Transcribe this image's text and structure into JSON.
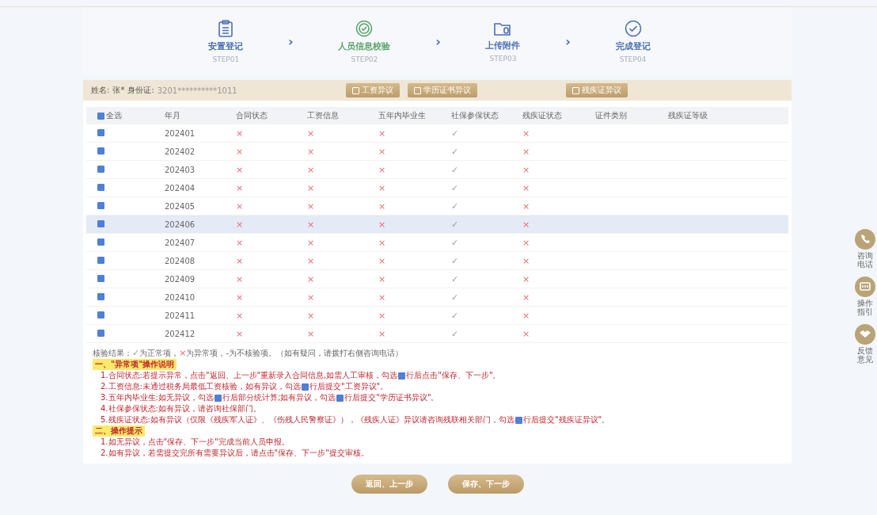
{
  "steps": [
    {
      "label": "安置登记",
      "sub": "STEP01",
      "selected": false
    },
    {
      "label": "人员信息校验",
      "sub": "STEP02",
      "selected": true
    },
    {
      "label": "上传附件",
      "sub": "STEP03",
      "selected": false
    },
    {
      "label": "完成登记",
      "sub": "STEP04",
      "selected": false
    }
  ],
  "step_separator": "›",
  "person": {
    "name_label": "姓名:",
    "name": "张*",
    "id_label": "身份证:",
    "id": "3201**********1011"
  },
  "objection_buttons": [
    "工资异议",
    "学历证书异议",
    "残疾证异议"
  ],
  "table": {
    "select_all": {
      "label": "全选",
      "checked": true
    },
    "columns": [
      "年月",
      "合同状态",
      "工资信息",
      "五年内毕业生",
      "社保参保状态",
      "残疾证状态",
      "证件类别",
      "残疾证等级"
    ],
    "rows": [
      {
        "month": "202401",
        "checked": true,
        "selected": false,
        "marks": [
          {
            "text": "×",
            "ok": false
          },
          {
            "text": "×",
            "ok": false
          },
          {
            "text": "×",
            "ok": false
          },
          {
            "text": "✓",
            "ok": true
          },
          {
            "text": "×",
            "ok": false
          }
        ]
      },
      {
        "month": "202402",
        "checked": true,
        "selected": false,
        "marks": [
          {
            "text": "×",
            "ok": false
          },
          {
            "text": "×",
            "ok": false
          },
          {
            "text": "×",
            "ok": false
          },
          {
            "text": "✓",
            "ok": true
          },
          {
            "text": "×",
            "ok": false
          }
        ]
      },
      {
        "month": "202403",
        "checked": true,
        "selected": false,
        "marks": [
          {
            "text": "×",
            "ok": false
          },
          {
            "text": "×",
            "ok": false
          },
          {
            "text": "×",
            "ok": false
          },
          {
            "text": "✓",
            "ok": true
          },
          {
            "text": "×",
            "ok": false
          }
        ]
      },
      {
        "month": "202404",
        "checked": true,
        "selected": false,
        "marks": [
          {
            "text": "×",
            "ok": false
          },
          {
            "text": "×",
            "ok": false
          },
          {
            "text": "×",
            "ok": false
          },
          {
            "text": "✓",
            "ok": true
          },
          {
            "text": "×",
            "ok": false
          }
        ]
      },
      {
        "month": "202405",
        "checked": true,
        "selected": false,
        "marks": [
          {
            "text": "×",
            "ok": false
          },
          {
            "text": "×",
            "ok": false
          },
          {
            "text": "×",
            "ok": false
          },
          {
            "text": "✓",
            "ok": true
          },
          {
            "text": "×",
            "ok": false
          }
        ]
      },
      {
        "month": "202406",
        "checked": true,
        "selected": true,
        "marks": [
          {
            "text": "×",
            "ok": false
          },
          {
            "text": "×",
            "ok": false
          },
          {
            "text": "×",
            "ok": false
          },
          {
            "text": "✓",
            "ok": true
          },
          {
            "text": "×",
            "ok": false
          }
        ]
      },
      {
        "month": "202407",
        "checked": true,
        "selected": false,
        "marks": [
          {
            "text": "×",
            "ok": false
          },
          {
            "text": "×",
            "ok": false
          },
          {
            "text": "×",
            "ok": false
          },
          {
            "text": "✓",
            "ok": true
          },
          {
            "text": "×",
            "ok": false
          }
        ]
      },
      {
        "month": "202408",
        "checked": true,
        "selected": false,
        "marks": [
          {
            "text": "×",
            "ok": false
          },
          {
            "text": "×",
            "ok": false
          },
          {
            "text": "×",
            "ok": false
          },
          {
            "text": "✓",
            "ok": true
          },
          {
            "text": "×",
            "ok": false
          }
        ]
      },
      {
        "month": "202409",
        "checked": true,
        "selected": false,
        "marks": [
          {
            "text": "×",
            "ok": false
          },
          {
            "text": "×",
            "ok": false
          },
          {
            "text": "×",
            "ok": false
          },
          {
            "text": "✓",
            "ok": true
          },
          {
            "text": "×",
            "ok": false
          }
        ]
      },
      {
        "month": "202410",
        "checked": true,
        "selected": false,
        "marks": [
          {
            "text": "×",
            "ok": false
          },
          {
            "text": "×",
            "ok": false
          },
          {
            "text": "×",
            "ok": false
          },
          {
            "text": "✓",
            "ok": true
          },
          {
            "text": "×",
            "ok": false
          }
        ]
      },
      {
        "month": "202411",
        "checked": true,
        "selected": false,
        "marks": [
          {
            "text": "×",
            "ok": false
          },
          {
            "text": "×",
            "ok": false
          },
          {
            "text": "×",
            "ok": false
          },
          {
            "text": "✓",
            "ok": true
          },
          {
            "text": "×",
            "ok": false
          }
        ]
      },
      {
        "month": "202412",
        "checked": true,
        "selected": false,
        "marks": [
          {
            "text": "×",
            "ok": false
          },
          {
            "text": "×",
            "ok": false
          },
          {
            "text": "×",
            "ok": false
          },
          {
            "text": "✓",
            "ok": true
          },
          {
            "text": "×",
            "ok": false
          }
        ]
      }
    ]
  },
  "legend": [
    {
      "text": "核验结果：",
      "kind": "plain"
    },
    {
      "text": "✓",
      "kind": "ok"
    },
    {
      "text": "为正常项，",
      "kind": "plain"
    },
    {
      "text": "×",
      "kind": "bad"
    },
    {
      "text": "为异常项，",
      "kind": "plain"
    },
    {
      "text": "-为不核验项。（如有疑问，请拨打右侧咨询电话）",
      "kind": "plain"
    }
  ],
  "sections": [
    {
      "title": "一、\"异常项\"操作说明",
      "lines": [
        [
          "1.合同状态:若提示异常，点击\"返回、上一步\"重新录入合同信息,如需人工审核，勾选",
          "行后点击\"保存、下一步\"。"
        ],
        [
          "2.工资信息:未通过税务局最低工资核验，如有异议，勾选",
          "行后提交\"工资异议\"。"
        ],
        [
          "3.五年内毕业生:如无异议，勾选",
          "行后部分统计算;如有异议，勾选",
          "行后提交\"学历证书异议\"。"
        ],
        [
          "4.社保参保状态:如有异议，请咨询社保部门。"
        ],
        [
          "5.残疾证状态:如有异议（仅限《残疾军人证》、《伤残人民警察证》），《残疾人证》异议请咨询残联相关部门，勾选",
          "行后提交\"残疾证异议\"。"
        ]
      ]
    },
    {
      "title": "二、操作提示",
      "lines": [
        [
          "1.如无异议，点击\"保存、下一步\"完成当前人员申报。"
        ],
        [
          "2.如有异议，若需提交完所有需要异议后，请点击\"保存、下一步\"提交审核。"
        ]
      ]
    }
  ],
  "footer_buttons": [
    "返回、上一步",
    "保存、下一步"
  ],
  "side_tools": [
    {
      "label": "咨询电话"
    },
    {
      "label": "操作指引"
    },
    {
      "label": "反馈意见"
    }
  ]
}
